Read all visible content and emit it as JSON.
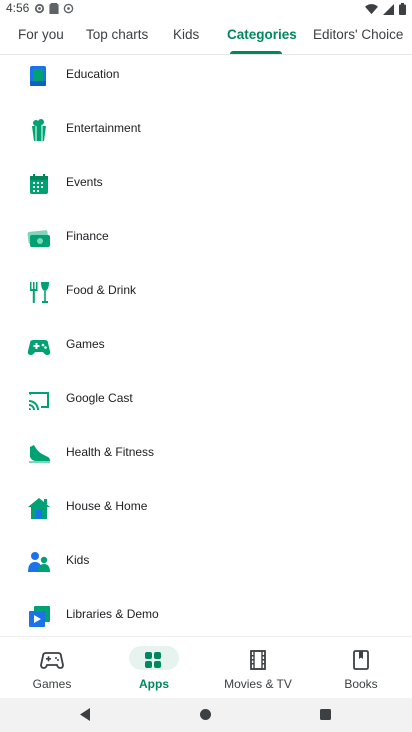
{
  "status_bar": {
    "time": "4:56",
    "left_icons": [
      "settings-status-icon",
      "sd-card-icon",
      "sync-icon"
    ],
    "right_icons": [
      "wifi-icon",
      "signal-icon",
      "battery-icon"
    ]
  },
  "tabs": [
    {
      "label": "For you",
      "active": false
    },
    {
      "label": "Top charts",
      "active": false
    },
    {
      "label": "Kids",
      "active": false
    },
    {
      "label": "Categories",
      "active": true
    },
    {
      "label": "Editors' Choice",
      "active": false
    }
  ],
  "categories": [
    {
      "label": "Education",
      "icon": "education-icon"
    },
    {
      "label": "Entertainment",
      "icon": "entertainment-icon"
    },
    {
      "label": "Events",
      "icon": "events-icon"
    },
    {
      "label": "Finance",
      "icon": "finance-icon"
    },
    {
      "label": "Food & Drink",
      "icon": "food-drink-icon"
    },
    {
      "label": "Games",
      "icon": "games-icon"
    },
    {
      "label": "Google Cast",
      "icon": "google-cast-icon"
    },
    {
      "label": "Health & Fitness",
      "icon": "health-fitness-icon"
    },
    {
      "label": "House & Home",
      "icon": "house-home-icon"
    },
    {
      "label": "Kids",
      "icon": "kids-icon"
    },
    {
      "label": "Libraries & Demo",
      "icon": "libraries-demo-icon"
    }
  ],
  "bottom_nav": [
    {
      "label": "Games",
      "icon": "gamepad-icon",
      "active": false
    },
    {
      "label": "Apps",
      "icon": "apps-grid-icon",
      "active": true
    },
    {
      "label": "Movies & TV",
      "icon": "film-icon",
      "active": false
    },
    {
      "label": "Books",
      "icon": "book-icon",
      "active": false
    }
  ],
  "colors": {
    "accent": "#01875f",
    "accent_light": "#e6f3ef",
    "teal": "#00a173",
    "blue": "#1a73e8"
  }
}
